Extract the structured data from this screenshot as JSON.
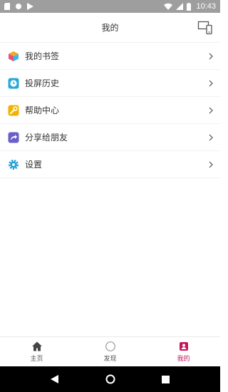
{
  "status_bar": {
    "time": "10:43"
  },
  "header": {
    "title": "我的"
  },
  "menu": {
    "items": [
      {
        "label": "我的书签",
        "icon": "cube-icon"
      },
      {
        "label": "投屏历史",
        "icon": "clock-icon"
      },
      {
        "label": "帮助中心",
        "icon": "wrench-icon"
      },
      {
        "label": "分享给朋友",
        "icon": "share-icon"
      },
      {
        "label": "设置",
        "icon": "gear-icon"
      }
    ]
  },
  "tabs": [
    {
      "label": "主页",
      "icon": "home-icon"
    },
    {
      "label": "发现",
      "icon": "discover-icon"
    },
    {
      "label": "我的",
      "icon": "profile-icon",
      "active": true
    }
  ],
  "colors": {
    "accent": "#c2185b",
    "clock": "#29a8d9",
    "wrench": "#f0b400",
    "share": "#6a5fc9",
    "gear": "#1f9fd8"
  }
}
